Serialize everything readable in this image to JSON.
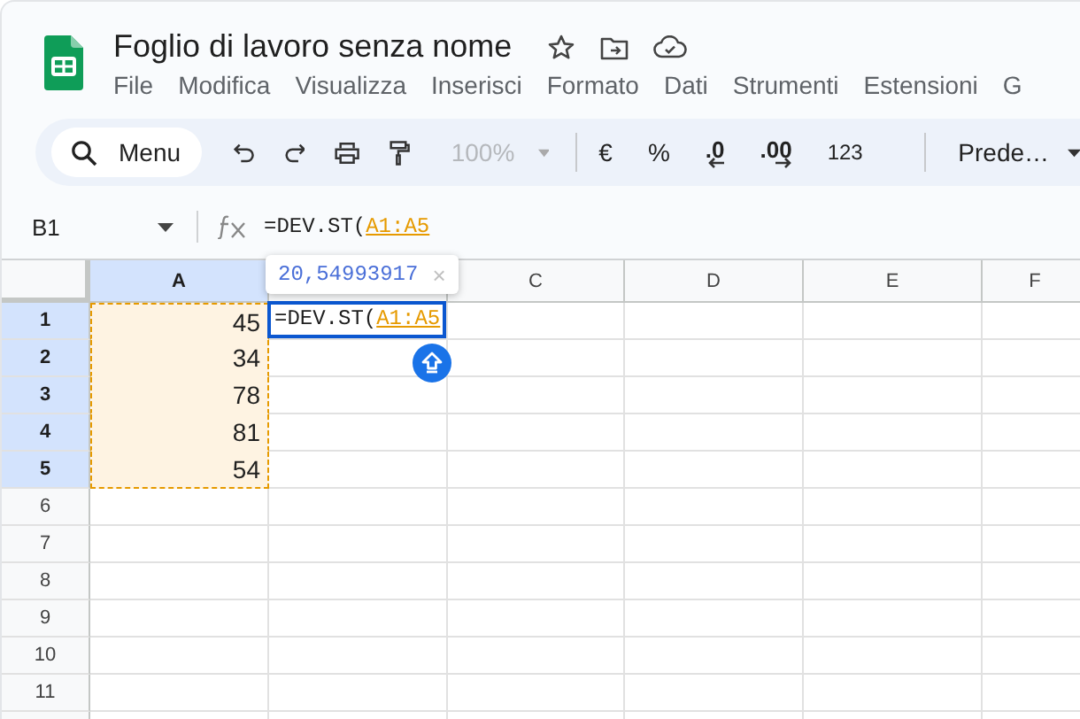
{
  "document": {
    "title": "Foglio di lavoro senza nome"
  },
  "menu": [
    "File",
    "Modifica",
    "Visualizza",
    "Inserisci",
    "Formato",
    "Dati",
    "Strumenti",
    "Estensioni",
    "G"
  ],
  "toolbar": {
    "search": "Menu",
    "zoom": "100%",
    "currency": "€",
    "percent": "%",
    "decrease_decimals": ".0",
    "increase_decimals": ".00",
    "number_format": "123",
    "font": "Prede…"
  },
  "name_box": "B1",
  "formula": {
    "function": "=DEV.ST(",
    "range": "A1:A5"
  },
  "preview": {
    "value": "20,54993917",
    "close": "×"
  },
  "columns": [
    {
      "label": "A",
      "highlighted": true
    },
    {
      "highlighted": false
    },
    {
      "label": "C",
      "highlighted": false
    },
    {
      "label": "D",
      "highlighted": false
    },
    {
      "label": "E",
      "highlighted": false
    },
    {
      "label": "F",
      "highlighted": false
    }
  ],
  "rows": [
    {
      "label": "1",
      "highlighted": true,
      "cells": [
        {
          "value": "45",
          "in_range": true
        },
        {
          "kind": "editor",
          "function": "=DEV.ST(",
          "range": "A1:A5"
        }
      ]
    },
    {
      "label": "2",
      "highlighted": true,
      "cells": [
        {
          "value": "34",
          "in_range": true
        }
      ]
    },
    {
      "label": "3",
      "highlighted": true,
      "cells": [
        {
          "value": "78",
          "in_range": true
        }
      ]
    },
    {
      "label": "4",
      "highlighted": true,
      "cells": [
        {
          "value": "81",
          "in_range": true
        }
      ]
    },
    {
      "label": "5",
      "highlighted": true,
      "cells": [
        {
          "value": "54",
          "in_range": true
        }
      ]
    },
    {
      "label": "6",
      "highlighted": false,
      "cells": []
    },
    {
      "label": "7",
      "highlighted": false,
      "cells": []
    },
    {
      "label": "8",
      "highlighted": false,
      "cells": []
    },
    {
      "label": "9",
      "highlighted": false,
      "cells": []
    },
    {
      "label": "10",
      "highlighted": false,
      "cells": []
    },
    {
      "label": "11",
      "highlighted": false,
      "cells": []
    }
  ]
}
